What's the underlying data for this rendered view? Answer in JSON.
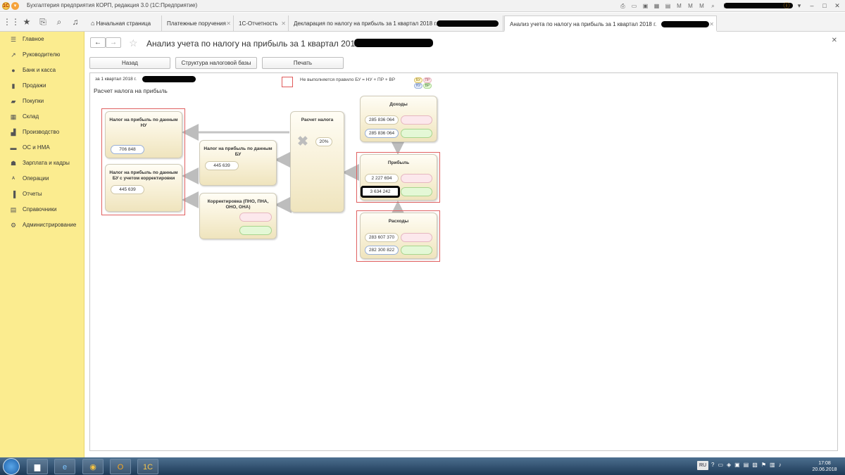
{
  "window": {
    "title": "Бухгалтерия предприятия КОРП, редакция 3.0  (1С:Предприятие)"
  },
  "tabs": [
    {
      "label": "Начальная страница"
    },
    {
      "label": "Платежные поручения"
    },
    {
      "label": "1С-Отчетность"
    },
    {
      "label": "Декларация по налогу на прибыль за 1 квартал 2018 г."
    },
    {
      "label": "Анализ учета по налогу на прибыль за 1 квартал 2018 г."
    }
  ],
  "sidebar": {
    "items": [
      {
        "label": "Главное",
        "icon": "menu-icon"
      },
      {
        "label": "Руководителю",
        "icon": "chart-line-icon"
      },
      {
        "label": "Банк и касса",
        "icon": "bank-icon"
      },
      {
        "label": "Продажи",
        "icon": "cart-icon"
      },
      {
        "label": "Покупки",
        "icon": "basket-icon"
      },
      {
        "label": "Склад",
        "icon": "warehouse-icon"
      },
      {
        "label": "Производство",
        "icon": "factory-icon"
      },
      {
        "label": "ОС и НМА",
        "icon": "assets-icon"
      },
      {
        "label": "Зарплата и кадры",
        "icon": "people-icon"
      },
      {
        "label": "Операции",
        "icon": "operations-icon"
      },
      {
        "label": "Отчеты",
        "icon": "bar-chart-icon"
      },
      {
        "label": "Справочники",
        "icon": "book-icon"
      },
      {
        "label": "Администрирование",
        "icon": "gear-icon"
      }
    ]
  },
  "page": {
    "title": "Анализ учета по налогу на прибыль за 1 квартал 2018 г.",
    "buttons": {
      "back": "Назад",
      "structure": "Структура налоговой базы",
      "print": "Печать"
    },
    "period": "за 1 квартал 2018 г.",
    "section_title": "Расчет налога на прибыль",
    "legend": {
      "text": "Не выполняется правило БУ = НУ + ПР + ВР",
      "tags": [
        "БУ",
        "ПР",
        "НУ",
        "ВР"
      ]
    }
  },
  "diagram": {
    "tax_nu": {
      "title": "Налог на прибыль по данным НУ",
      "value": "706 848"
    },
    "tax_bu_corr": {
      "title": "Налог на прибыль по данным БУ с учетом корректировки",
      "value": "445 639"
    },
    "tax_bu": {
      "title": "Налог на прибыль по данным БУ",
      "value": "445 639"
    },
    "correction": {
      "title": "Корректировка (ПНО, ПНА, ОНО, ОНА)"
    },
    "calc": {
      "title": "Расчет налога",
      "rate": "20%"
    },
    "income": {
      "title": "Доходы",
      "bu": "285 836 064",
      "nu": "285 836 064"
    },
    "profit": {
      "title": "Прибыль",
      "bu": "2 227 694",
      "nu": "3 634 242"
    },
    "expenses": {
      "title": "Расходы",
      "bu": "283 607 370",
      "nu": "282 300 822"
    }
  },
  "taskbar": {
    "lang": "RU",
    "time": "17:08",
    "date": "20.06.2018"
  },
  "colors": {
    "sidebar": "#fbec8f",
    "card_frame_error": "#e06060",
    "pill_pink": "#fce8ec",
    "pill_green": "#e4f8d6"
  }
}
